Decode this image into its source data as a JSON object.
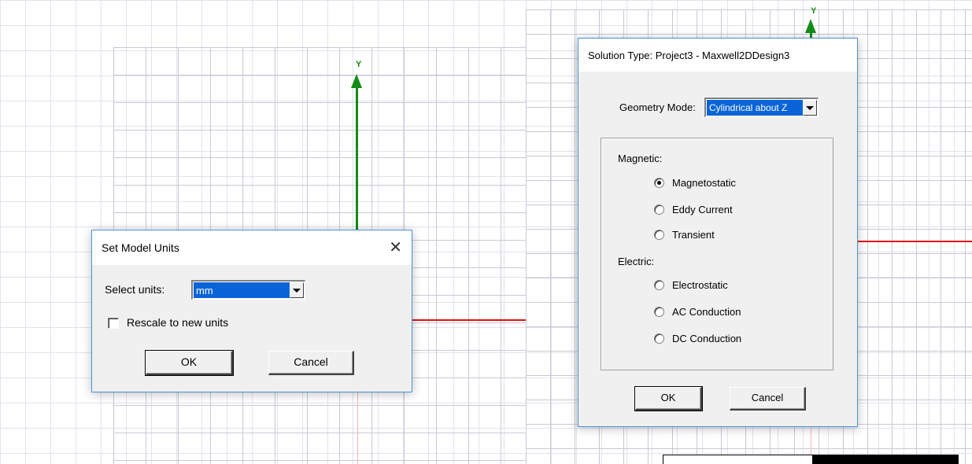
{
  "left_window": {
    "axis_label": "Y",
    "dialog": {
      "title": "Set Model Units",
      "close_glyph": "✕",
      "select_units_label": "Select units:",
      "units_value": "mm",
      "rescale_label": "Rescale to new units",
      "rescale_checked": false,
      "ok_label": "OK",
      "cancel_label": "Cancel"
    }
  },
  "right_window": {
    "axis_label": "Y",
    "dialog": {
      "title": "Solution Type: Project3 - Maxwell2DDesign3",
      "geometry_mode_label": "Geometry Mode:",
      "geometry_mode_value": "Cylindrical about Z",
      "magnetic_label": "Magnetic:",
      "magnetic_options": [
        {
          "label": "Magnetostatic",
          "checked": true
        },
        {
          "label": "Eddy Current",
          "checked": false
        },
        {
          "label": "Transient",
          "checked": false
        }
      ],
      "electric_label": "Electric:",
      "electric_options": [
        {
          "label": "Electrostatic",
          "checked": false
        },
        {
          "label": "AC Conduction",
          "checked": false
        },
        {
          "label": "DC Conduction",
          "checked": false
        }
      ],
      "ok_label": "OK",
      "cancel_label": "Cancel"
    }
  },
  "colors": {
    "y_axis": "#148c14",
    "x_axis": "#e01010",
    "grid": "#c9c9d6",
    "dialog_border": "#4a90d9",
    "selection": "#0a64d8"
  }
}
